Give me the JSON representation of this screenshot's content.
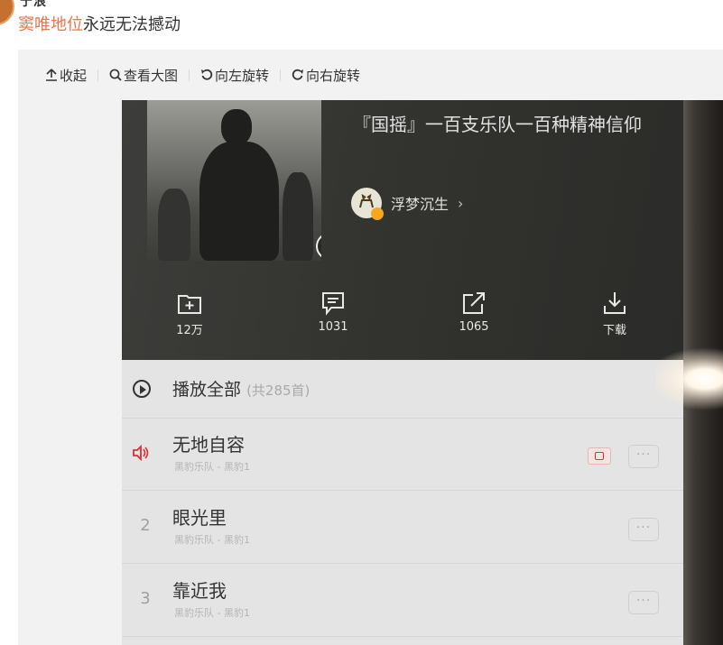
{
  "post": {
    "author_cut": "宁浪",
    "text_highlight": "窦唯地位",
    "text_rest": "永远无法撼动"
  },
  "toolbar": {
    "collapse": "收起",
    "view_large": "查看大图",
    "rotate_left": "向左旋转",
    "rotate_right": "向右旋转"
  },
  "playlist": {
    "title": "『国摇』一百支乐队一百种精神信仰",
    "creator": "浮梦沉生",
    "creator_arrow": "›",
    "info_glyph": "i",
    "actions": {
      "collect_count": "12万",
      "comment_count": "1031",
      "share_count": "1065",
      "download_label": "下载"
    },
    "play_all": {
      "label": "播放全部",
      "count": "(共285首)"
    },
    "tracks": [
      {
        "index": "",
        "title": "无地自容",
        "subtitle": "黑豹乐队 - 黑豹1"
      },
      {
        "index": "2",
        "title": "眼光里",
        "subtitle": "黑豹乐队 - 黑豹1"
      },
      {
        "index": "3",
        "title": "靠近我",
        "subtitle": "黑豹乐队 - 黑豹1"
      }
    ],
    "more_glyph": "···"
  },
  "colors": {
    "highlight": "#eb7350",
    "playing_red": "#d33333",
    "toolbar_bg": "#f2f2f2"
  }
}
